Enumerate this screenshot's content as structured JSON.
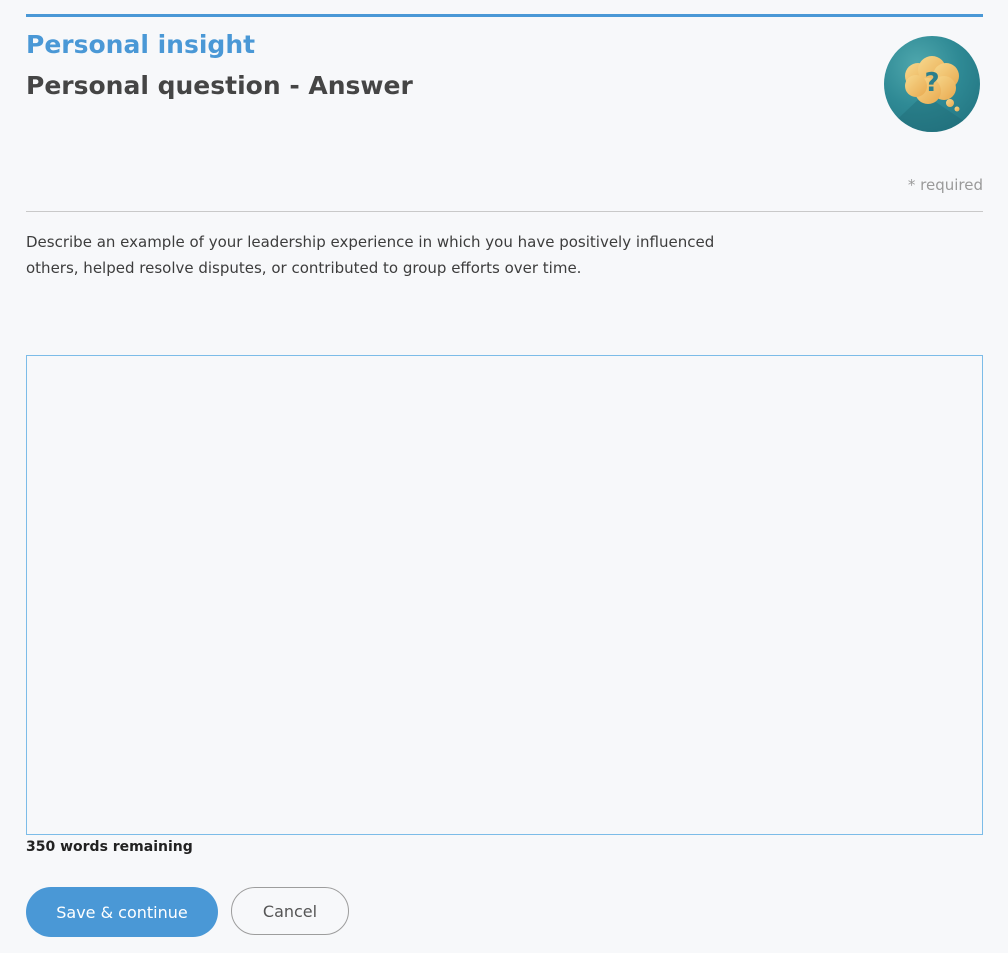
{
  "header": {
    "section_title": "Personal insight",
    "page_title": "Personal question - Answer",
    "badge_icon": "thought-bubble-question-icon",
    "badge_glyph": "?"
  },
  "form": {
    "required_note": "* required",
    "prompt": "Describe an example of your leadership experience in which you have positively influenced others, helped resolve disputes, or contributed to group efforts over time.",
    "answer_value": "",
    "words_remaining": "350 words remaining"
  },
  "actions": {
    "save_label": "Save & continue",
    "cancel_label": "Cancel"
  },
  "colors": {
    "accent": "#4a98d6",
    "badge_teal": "#2f8a95",
    "bubble_gold": "#f2c56b",
    "textarea_border": "#7cbce8"
  }
}
